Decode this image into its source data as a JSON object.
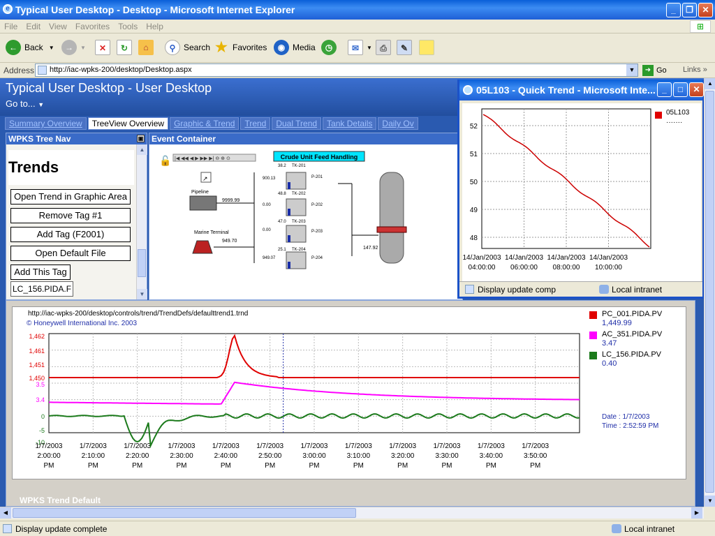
{
  "window": {
    "title": "Typical User Desktop - Desktop - Microsoft Internet Explorer"
  },
  "menu": [
    "File",
    "Edit",
    "View",
    "Favorites",
    "Tools",
    "Help"
  ],
  "toolbar": {
    "back": "Back",
    "search": "Search",
    "favorites": "Favorites",
    "media": "Media"
  },
  "address": {
    "label": "Address",
    "url": "http://iac-wpks-200/desktop/Desktop.aspx",
    "go": "Go",
    "links": "Links"
  },
  "app": {
    "title": "Typical User Desktop - User Desktop",
    "goto": "Go to...",
    "tabs": [
      "Summary Overview",
      "TreeView Overview",
      "Graphic & Trend",
      "Trend",
      "Dual Trend",
      "Tank Details",
      "Daily Ov"
    ],
    "active_tab": 1
  },
  "nav": {
    "header": "WPKS Tree Nav",
    "heading": "Trends",
    "buttons": [
      "Open Trend in Graphic Area",
      "Remove Tag #1",
      "Add Tag (F2001)",
      "Open Default File"
    ],
    "add_tag": "Add This Tag",
    "tag_value": "LC_156.PIDA.F"
  },
  "event": {
    "header": "Event Container",
    "graphic_title": "Crude Unit Feed Handling",
    "pipeline": "Pipeline",
    "marine": "Marine Terminal",
    "pipeline_val": "9999.99",
    "marine_val": "949.70",
    "column_val": "147.92",
    "tanks": [
      {
        "name": "TK-201",
        "level": "38.2",
        "flow": "900.13",
        "pump": "P-201"
      },
      {
        "name": "TK-202",
        "level": "48.8",
        "flow": "0.00",
        "pump": "P-202"
      },
      {
        "name": "TK-203",
        "level": "47.0",
        "flow": "0.00",
        "pump": "P-203"
      },
      {
        "name": "TK-204",
        "level": "25.1",
        "flow": "949.07",
        "pump": "P-204"
      }
    ]
  },
  "trend": {
    "url": "http://iac-wpks-200/desktop/controls/trend/TrendDefs/defaulttrend1.trnd",
    "copyright": "© Honeywell International Inc. 2003",
    "legend": [
      {
        "name": "PC_001.PIDA.PV",
        "value": "1,449.99",
        "color": "#e00000"
      },
      {
        "name": "AC_351.PIDA.PV",
        "value": "3.47",
        "color": "#ff00ff"
      },
      {
        "name": "LC_156.PIDA.PV",
        "value": "0.40",
        "color": "#1b7a1b"
      }
    ],
    "date": "Date : 1/7/2003",
    "time": "Time : 2:52:59 PM",
    "yticks_red": [
      "1,462",
      "1,461",
      "1,451",
      "1,450"
    ],
    "yticks_mag": [
      "3.5",
      "3.4"
    ],
    "yticks_grn": [
      "0",
      "-5",
      "-10"
    ],
    "xticks": [
      [
        "1/7/2003",
        "2:00:00",
        "PM"
      ],
      [
        "1/7/2003",
        "2:10:00",
        "PM"
      ],
      [
        "1/7/2003",
        "2:20:00",
        "PM"
      ],
      [
        "1/7/2003",
        "2:30:00",
        "PM"
      ],
      [
        "1/7/2003",
        "2:40:00",
        "PM"
      ],
      [
        "1/7/2003",
        "2:50:00",
        "PM"
      ],
      [
        "1/7/2003",
        "3:00:00",
        "PM"
      ],
      [
        "1/7/2003",
        "3:10:00",
        "PM"
      ],
      [
        "1/7/2003",
        "3:20:00",
        "PM"
      ],
      [
        "1/7/2003",
        "3:30:00",
        "PM"
      ],
      [
        "1/7/2003",
        "3:40:00",
        "PM"
      ],
      [
        "1/7/2003",
        "3:50:00",
        "PM"
      ]
    ]
  },
  "bottom_panel": "WPKS Trend Default",
  "status": {
    "text": "Display update complete",
    "zone": "Local intranet"
  },
  "popup": {
    "title": "05L103 - Quick Trend - Microsoft Inte...",
    "legend": "05L103",
    "yticks": [
      "52",
      "51",
      "50",
      "49",
      "48"
    ],
    "xticks": [
      [
        "14/Jan/2003",
        "04:00:00"
      ],
      [
        "14/Jan/2003",
        "06:00:00"
      ],
      [
        "14/Jan/2003",
        "08:00:00"
      ],
      [
        "14/Jan/2003",
        "10:00:00"
      ]
    ],
    "status": "Display update comp",
    "zone": "Local intranet"
  },
  "chart_data": [
    {
      "type": "line",
      "x": [
        "2:00",
        "2:10",
        "2:20",
        "2:30",
        "2:40",
        "2:50",
        "3:00",
        "3:10",
        "3:20",
        "3:30",
        "3:40",
        "3:50"
      ],
      "series": [
        {
          "name": "PC_001.PIDA.PV",
          "values": [
            1450,
            1450,
            1450,
            1450,
            1450,
            1450,
            1450,
            1450,
            1450,
            1450,
            1450,
            1450
          ],
          "peak": {
            "x": "2:42",
            "value": 1462
          }
        },
        {
          "name": "AC_351.PIDA.PV",
          "values": [
            3.38,
            3.37,
            3.37,
            3.37,
            3.37,
            3.5,
            3.46,
            3.43,
            3.41,
            3.4,
            3.39,
            3.39
          ]
        },
        {
          "name": "LC_156.PIDA.PV",
          "values": [
            0,
            0,
            -10,
            0,
            0,
            0,
            0,
            0,
            0,
            0,
            0,
            0
          ]
        }
      ]
    },
    {
      "type": "line",
      "x": [
        "14/Jan/2003 04:00:00",
        "14/Jan/2003 06:00:00",
        "14/Jan/2003 08:00:00",
        "14/Jan/2003 10:00:00"
      ],
      "series": [
        {
          "name": "05L103",
          "values": [
            52.4,
            51.2,
            50.0,
            48.7
          ]
        }
      ],
      "ylim": [
        47.6,
        52.6
      ]
    }
  ]
}
